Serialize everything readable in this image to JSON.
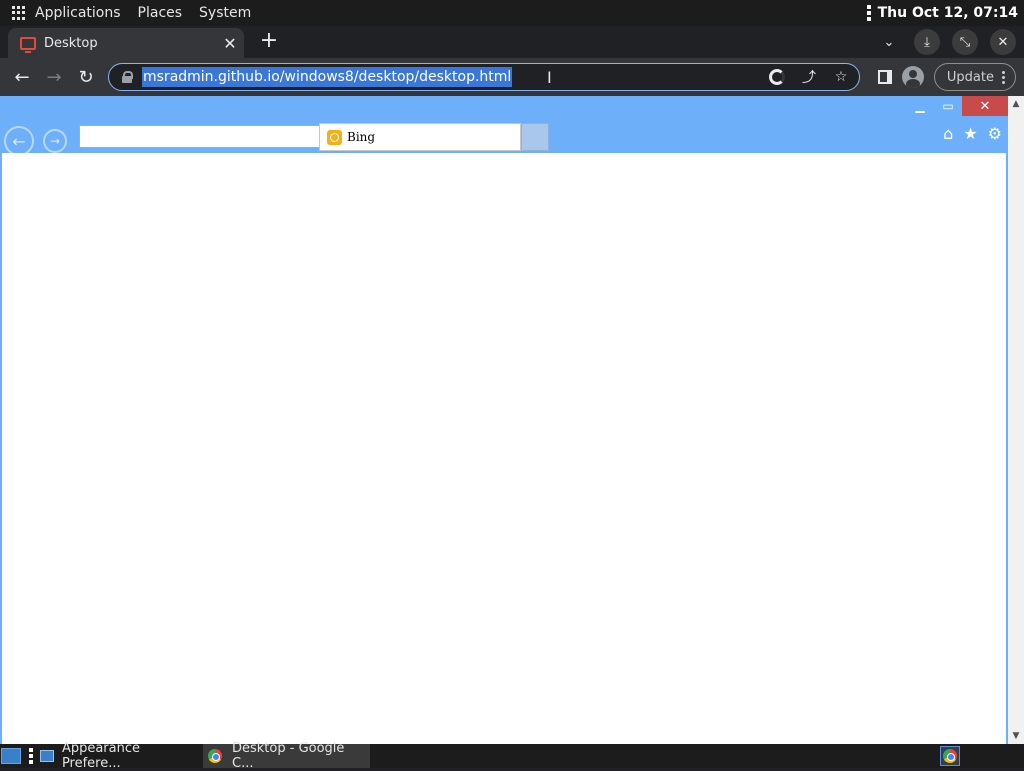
{
  "top_panel": {
    "menus": [
      "Applications",
      "Places",
      "System"
    ],
    "clock": "Thu Oct 12, 07:14"
  },
  "browser": {
    "tab": {
      "title": "Desktop"
    },
    "omnibox": {
      "url": "msradmin.github.io/windows8/desktop/desktop.html"
    },
    "update_label": "Update"
  },
  "ie_window": {
    "search_provider": "Bing",
    "address_value": ""
  },
  "taskbar": {
    "items": [
      {
        "label": "Appearance Prefere..."
      },
      {
        "label": "Desktop - Google C..."
      }
    ]
  }
}
